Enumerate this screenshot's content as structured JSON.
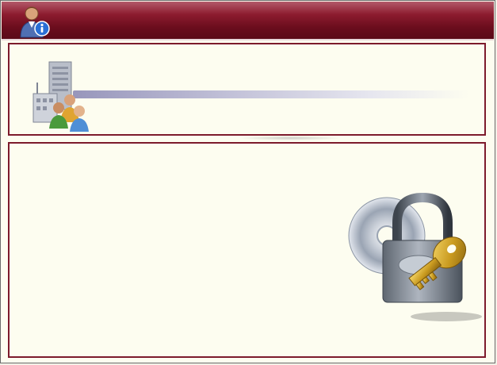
{
  "window": {
    "title": ""
  },
  "header": {
    "icon": "user-info-icon"
  },
  "top_panel": {
    "heading": "",
    "icon": "company-people-icon"
  },
  "main_panel": {
    "illustration": "lock-key-disc-icon"
  },
  "colors": {
    "titlebar": "#6a0d1d",
    "panel_border": "#7d1b2c",
    "panel_background": "#fdfdf0"
  }
}
